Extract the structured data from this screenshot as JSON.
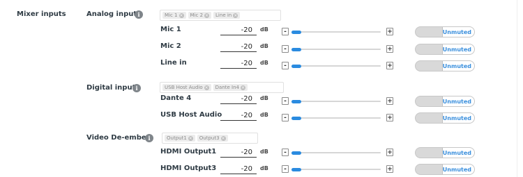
{
  "section": {
    "title": "Mixer inputs"
  },
  "groups": [
    {
      "label": "Analog input",
      "tags": [
        "Mic 1",
        "Mic 2",
        "Line in"
      ],
      "channels": [
        {
          "name": "Mic 1",
          "value": "-20",
          "unit": "dB",
          "level": 0.0,
          "mute_label": "Unmuted"
        },
        {
          "name": "Mic 2",
          "value": "-20",
          "unit": "dB",
          "level": 0.0,
          "mute_label": "Unmuted"
        },
        {
          "name": "Line in",
          "value": "-20",
          "unit": "dB",
          "level": 0.0,
          "mute_label": "Unmuted"
        }
      ]
    },
    {
      "label": "Digital input",
      "tags": [
        "USB Host Audio",
        "Dante In4"
      ],
      "channels": [
        {
          "name": "Dante 4",
          "value": "-20",
          "unit": "dB",
          "level": 0.0,
          "mute_label": "Unmuted"
        },
        {
          "name": "USB Host Audio",
          "value": "-20",
          "unit": "dB",
          "level": 0.0,
          "mute_label": "Unmuted"
        }
      ]
    },
    {
      "label": "Video De-embed",
      "tags": [
        "Output1",
        "Output3"
      ],
      "channels": [
        {
          "name": "HDMI Output1",
          "value": "-20",
          "unit": "dB",
          "level": 0.0,
          "mute_label": "Unmuted"
        },
        {
          "name": "HDMI Output3",
          "value": "-20",
          "unit": "dB",
          "level": 0.0,
          "mute_label": "Unmuted"
        }
      ]
    }
  ],
  "controls": {
    "minus": "-",
    "plus": "+",
    "info": "i",
    "tag_remove": "×"
  },
  "colors": {
    "accent": "#2a8be0",
    "toggle_text": "#3a8fdd",
    "toggle_off_bg": "#d9d9d9"
  }
}
